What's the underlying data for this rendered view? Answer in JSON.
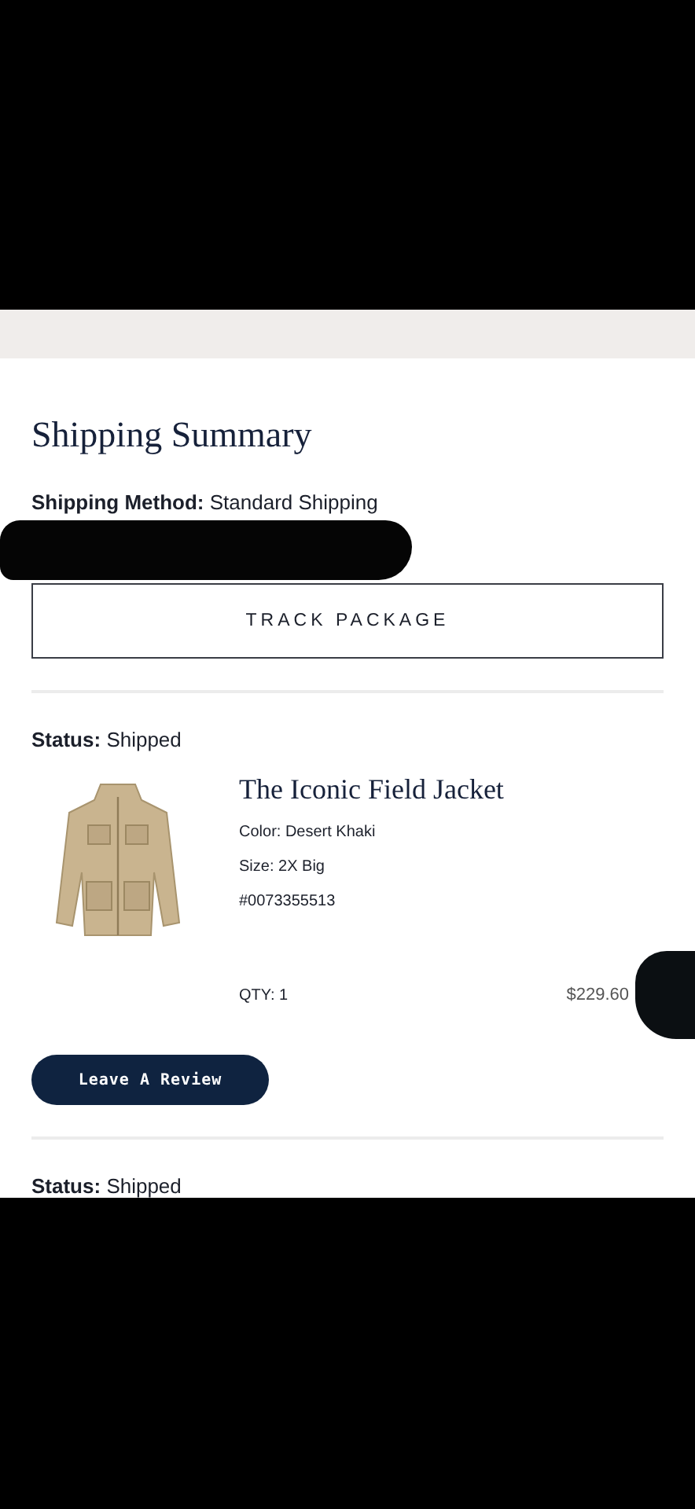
{
  "section_title": "Shipping Summary",
  "shipping_method": {
    "label": "Shipping Method:",
    "value": "Standard Shipping"
  },
  "track_button": "TRACK PACKAGE",
  "shipments": [
    {
      "status_label": "Status:",
      "status": "Shipped",
      "product": {
        "name": "The Iconic Field Jacket",
        "variant": "Color: Desert Khaki",
        "size": "Size: 2X Big",
        "sku": "#0073355513",
        "qty": "QTY: 1",
        "price": "$229.60"
      },
      "review_button": "Leave A Review"
    },
    {
      "status_label": "Status:",
      "status": "Shipped"
    }
  ]
}
